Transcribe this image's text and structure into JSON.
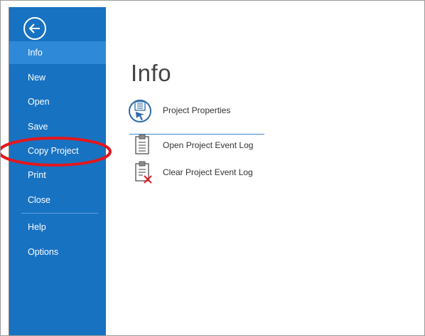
{
  "backstage": {
    "back_icon": "back-arrow-icon",
    "nav_items": [
      {
        "label": "Info",
        "selected": true
      },
      {
        "label": "New"
      },
      {
        "label": "Open"
      },
      {
        "label": "Save"
      },
      {
        "label": "Copy Project"
      },
      {
        "label": "Print"
      },
      {
        "label": "Close"
      },
      {
        "label": "Help"
      },
      {
        "label": "Options"
      }
    ],
    "colors": {
      "sidebar": "#1872c2",
      "selected": "#2e8ad8",
      "annotation": "#e3161d"
    }
  },
  "main": {
    "title": "Info",
    "actions": [
      {
        "label": "Project Properties",
        "icon": "project-properties-icon"
      },
      {
        "label": "Open Project Event Log",
        "icon": "clipboard-log-icon"
      },
      {
        "label": "Clear Project Event Log",
        "icon": "clipboard-clear-icon"
      }
    ]
  }
}
